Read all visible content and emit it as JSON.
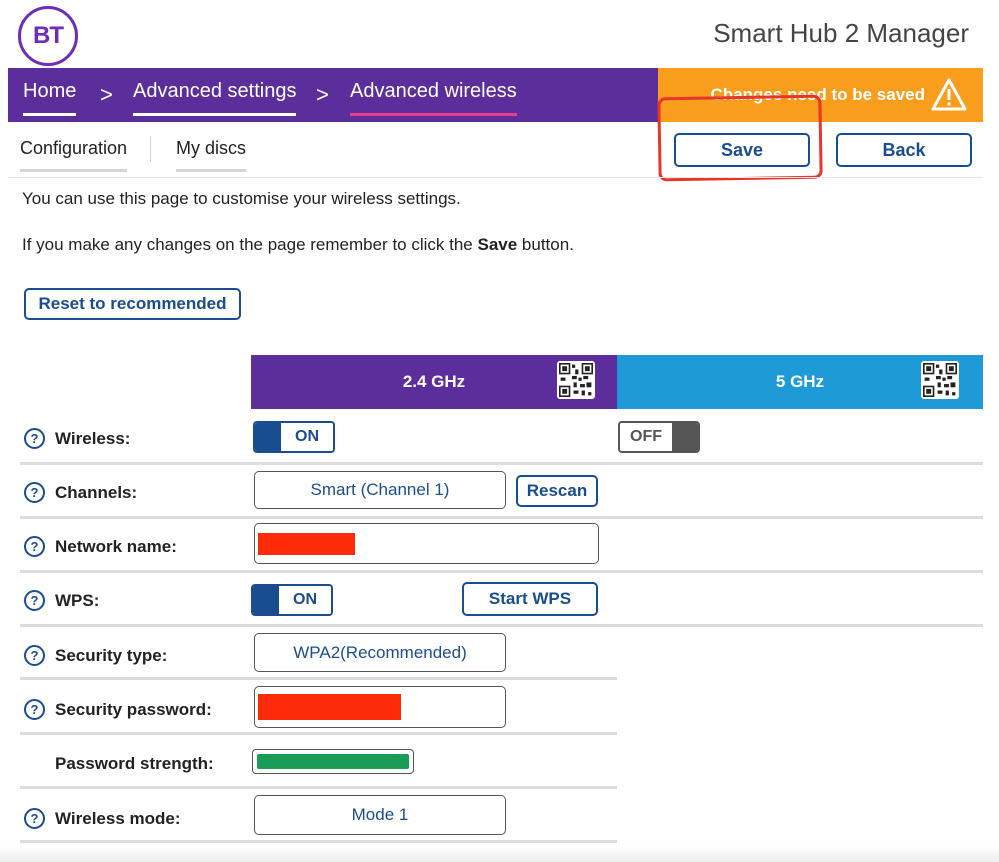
{
  "header": {
    "logo_text": "BT",
    "app_title": "Smart Hub 2 Manager"
  },
  "breadcrumb": {
    "items": [
      {
        "label": "Home"
      },
      {
        "label": "Advanced settings"
      },
      {
        "label": "Advanced wireless"
      }
    ],
    "separator": ">",
    "active_index": 2
  },
  "notice": {
    "text": "Changes need to be saved",
    "color": "#f99d1c"
  },
  "tabs": [
    {
      "label": "Configuration",
      "active": true
    },
    {
      "label": "My discs",
      "active": false
    }
  ],
  "toolbar": {
    "save_label": "Save",
    "back_label": "Back"
  },
  "intro": {
    "line1": "You can use this page to customise your wireless settings.",
    "line2_prefix": "If you make any changes on the page remember to click the ",
    "line2_bold": "Save",
    "line2_suffix": " button."
  },
  "reset_label": "Reset to recommended",
  "bands": {
    "band_24": {
      "label": "2.4 GHz",
      "color": "#5c2e9c"
    },
    "band_5": {
      "label": "5 GHz",
      "color": "#1e9bd7"
    }
  },
  "settings": {
    "help_glyph": "?",
    "wireless": {
      "label": "Wireless:",
      "band24_state": "ON",
      "band5_state": "OFF"
    },
    "channels": {
      "label": "Channels:",
      "value": "Smart (Channel 1)",
      "rescan_label": "Rescan"
    },
    "network_name": {
      "label": "Network name:"
    },
    "wps": {
      "label": "WPS:",
      "state": "ON",
      "start_label": "Start WPS"
    },
    "security_type": {
      "label": "Security type:",
      "value": "WPA2(Recommended)"
    },
    "security_password": {
      "label": "Security password:"
    },
    "password_strength": {
      "label": "Password strength:",
      "level": 1.0,
      "color": "#1a9c57"
    },
    "wireless_mode": {
      "label": "Wireless mode:",
      "value": "Mode 1"
    }
  },
  "colors": {
    "brand_purple": "#5c2e9c",
    "accent_pink": "#e93e8f",
    "button_blue": "#1a4d8f",
    "redaction_red": "#fe2b0b",
    "annotation_red": "#e8352a"
  }
}
